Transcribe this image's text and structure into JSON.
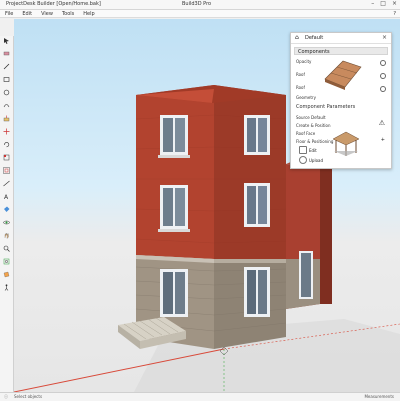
{
  "window": {
    "title_left": "ProjectDesk Builder [Open/Home.bak]",
    "title_mid": "Build3D Pro",
    "minimize_icon": "minimize-icon",
    "maximize_icon": "maximize-icon",
    "close_icon": "close-icon"
  },
  "menu": [
    "File",
    "Edit",
    "View",
    "Tools",
    "Help"
  ],
  "menu_help_symbol": "?",
  "panel": {
    "title": "Default",
    "close_symbol": "×",
    "section1": "Components",
    "rows1": [
      "Opacity",
      "Roof",
      "Roof",
      "Geometry"
    ],
    "section2_label": "Component Parameters",
    "rows2": [
      "Source  Default",
      "Create & Position",
      "Roof Face",
      "Floor & Positioning"
    ],
    "button_label": "Edit",
    "button2_label": "Upload",
    "warning_symbol": "⚠",
    "zoom_label": "+"
  },
  "status": {
    "left": "Select objects",
    "right": "Measurements"
  },
  "colors": {
    "brick": "#b2432f",
    "brick_dark": "#8e3323",
    "stone": "#9a8f82",
    "sky_top": "#bfe0f4",
    "ground": "#e6e6e6",
    "axis_red": "#d84a3a"
  }
}
